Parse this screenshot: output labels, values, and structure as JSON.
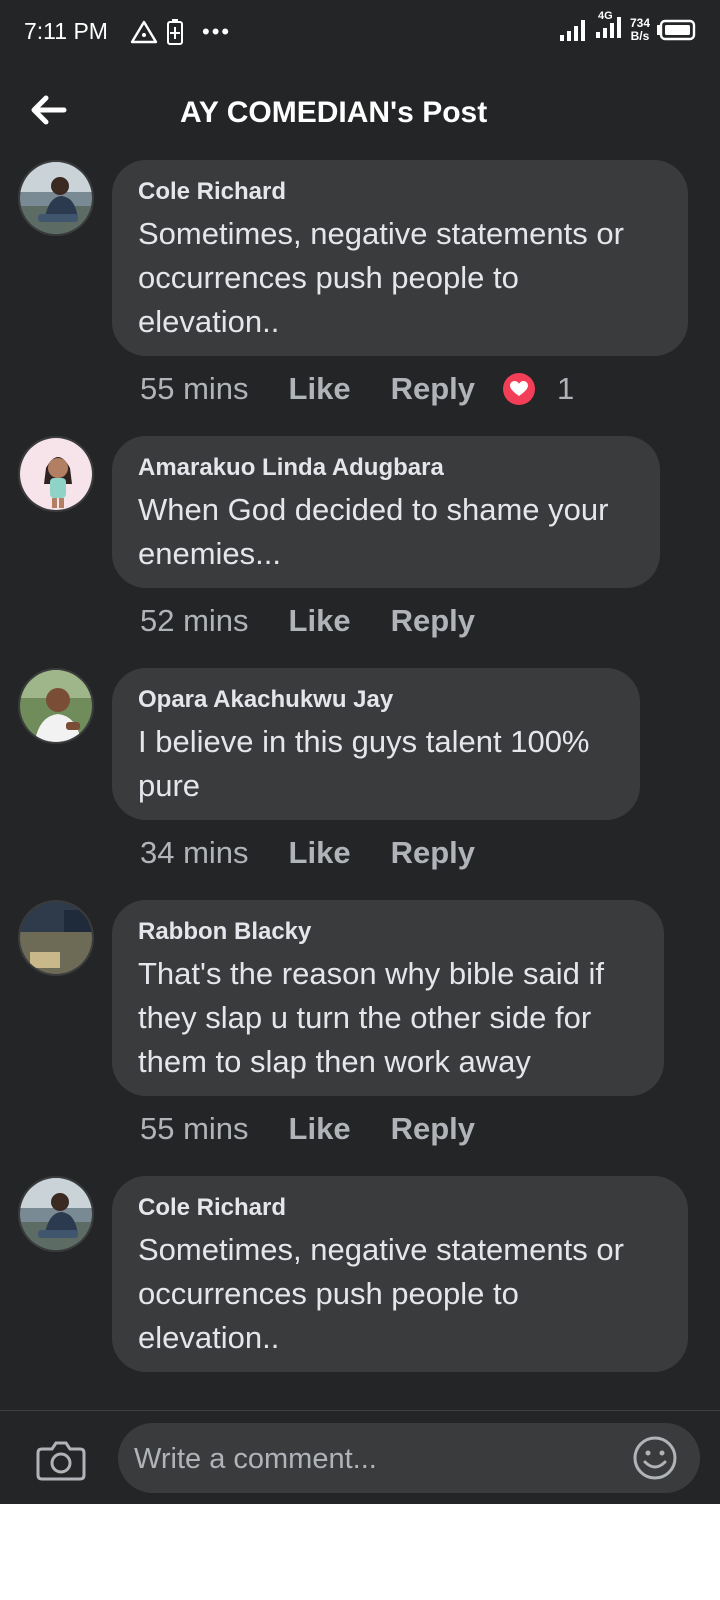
{
  "status_bar": {
    "time": "7:11 PM",
    "network": "4G",
    "speed_value": "734",
    "speed_unit": "B/s",
    "more": "•••"
  },
  "header": {
    "title": "AY COMEDIAN's Post",
    "back_icon": "arrow-left-icon"
  },
  "comments": [
    {
      "author": "Cole Richard",
      "text": "Sometimes, negative statements or occurrences push people to elevation..",
      "time": "55 mins",
      "like": "Like",
      "reply": "Reply",
      "reaction_icon": "love-reaction-icon",
      "reaction_count": "1"
    },
    {
      "author": "Amarakuo Linda Adugbara",
      "text": "When God decided to shame your enemies...",
      "time": "52 mins",
      "like": "Like",
      "reply": "Reply"
    },
    {
      "author": "Opara Akachukwu Jay",
      "text": "I believe in this guys talent 100% pure",
      "time": "34 mins",
      "like": "Like",
      "reply": "Reply"
    },
    {
      "author": "Rabbon Blacky",
      "text": "That's the reason why bible said if they slap u turn the other side for them to slap then work away",
      "time": "55 mins",
      "like": "Like",
      "reply": "Reply"
    },
    {
      "author": "Cole Richard",
      "text": "Sometimes, negative statements or occurrences push people to elevation.."
    }
  ],
  "composer": {
    "placeholder": "Write a comment...",
    "camera_icon": "camera-icon",
    "emoji_icon": "smiley-icon"
  },
  "colors": {
    "background": "#242526",
    "bubble": "#3a3b3c",
    "text": "#e4e6eb",
    "muted": "#b0b3b8",
    "love": "#f33e58"
  }
}
